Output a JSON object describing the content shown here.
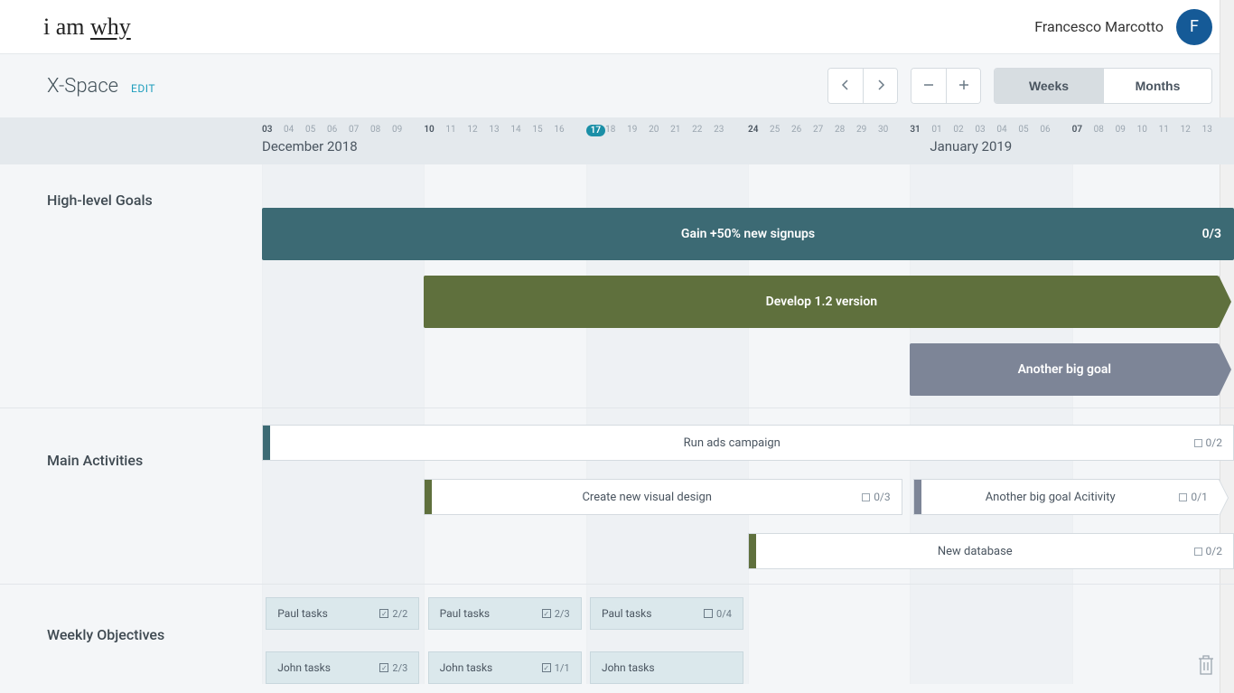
{
  "header": {
    "logo_prefix": "i am ",
    "logo_word": "why",
    "user_name": "Francesco Marcotto",
    "avatar_initial": "F"
  },
  "subheader": {
    "space_title": "X-Space",
    "edit_label": "EDIT",
    "view_weeks": "Weeks",
    "view_months": "Months"
  },
  "timeline": {
    "month_left": "December 2018",
    "month_right": "January 2019",
    "weeks": [
      {
        "days": [
          "03",
          "04",
          "05",
          "06",
          "07",
          "08",
          "09"
        ],
        "first": "03"
      },
      {
        "days": [
          "10",
          "11",
          "12",
          "13",
          "14",
          "15",
          "16"
        ],
        "first": "10"
      },
      {
        "days": [
          "17",
          "18",
          "19",
          "20",
          "21",
          "22",
          "23"
        ],
        "today": "17"
      },
      {
        "days": [
          "24",
          "25",
          "26",
          "27",
          "28",
          "29",
          "30"
        ],
        "first": "24"
      },
      {
        "days": [
          "31",
          "01",
          "02",
          "03",
          "04",
          "05",
          "06"
        ],
        "first": "31"
      },
      {
        "days": [
          "07",
          "08",
          "09",
          "10",
          "11",
          "12",
          "13"
        ],
        "first": "07"
      }
    ]
  },
  "sections": {
    "goals_label": "High-level Goals",
    "activities_label": "Main Activities",
    "objectives_label": "Weekly Objectives"
  },
  "goals": [
    {
      "label": "Gain +50% new signups",
      "count": "0/3"
    },
    {
      "label": "Develop 1.2 version",
      "count": ""
    },
    {
      "label": "Another big goal",
      "count": ""
    }
  ],
  "activities": [
    {
      "label": "Run ads campaign",
      "count": "0/2"
    },
    {
      "label": "Create new visual design",
      "count": "0/3"
    },
    {
      "label": "Another big goal Acitivity",
      "count": "0/1"
    },
    {
      "label": "New database",
      "count": "0/2"
    }
  ],
  "objectives": {
    "row1": [
      {
        "label": "Paul tasks",
        "count": "2/2",
        "check": true
      },
      {
        "label": "Paul tasks",
        "count": "2/3",
        "check": true
      },
      {
        "label": "Paul tasks",
        "count": "0/4",
        "check": false
      }
    ],
    "row2": [
      {
        "label": "John tasks",
        "count": "2/3",
        "check": true
      },
      {
        "label": "John tasks",
        "count": "1/1",
        "check": true
      },
      {
        "label": "John tasks",
        "count": "",
        "check": false
      }
    ]
  }
}
